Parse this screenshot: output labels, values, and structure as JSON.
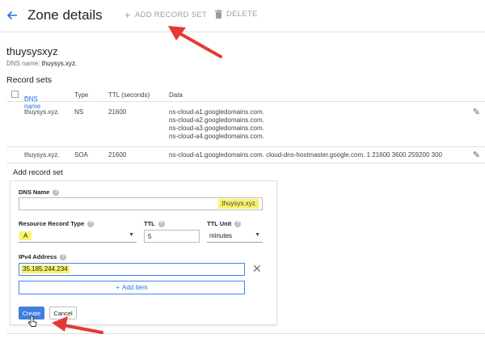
{
  "header": {
    "title": "Zone details",
    "add_record_set": "ADD RECORD SET",
    "delete": "DELETE"
  },
  "zone": {
    "name": "thuysysxyz",
    "dns_label": "DNS name:",
    "dns_value": "thuysys.xyz."
  },
  "record_sets": {
    "title": "Record sets",
    "columns": {
      "dns_name": "DNS name",
      "type": "Type",
      "ttl": "TTL (seconds)",
      "data": "Data"
    },
    "rows": [
      {
        "dns_name": "thuysys.xyz.",
        "type": "NS",
        "ttl": "21600",
        "data": [
          "ns-cloud-a1.googledomains.com.",
          "ns-cloud-a2.googledomains.com.",
          "ns-cloud-a3.googledomains.com.",
          "ns-cloud-a4.googledomains.com."
        ]
      },
      {
        "dns_name": "thuysys.xyz.",
        "type": "SOA",
        "ttl": "21600",
        "data": [
          "ns-cloud-a1.googledomains.com. cloud-dns-hostmaster.google.com. 1 21600 3600 259200 300"
        ]
      }
    ]
  },
  "add_record": {
    "title": "Add record set",
    "dns_name_label": "DNS Name",
    "dns_name_value": "",
    "dns_suffix": ".thuysys.xyz.",
    "rr_type_label": "Resource Record Type",
    "rr_type_value": "A",
    "ttl_label": "TTL",
    "ttl_value": "5",
    "ttl_unit_label": "TTL Unit",
    "ttl_unit_value": "minutes",
    "ipv4_label": "IPv4 Address",
    "ipv4_value": "35.185.244.234",
    "add_item": "Add item",
    "create": "Create",
    "cancel": "Cancel"
  },
  "icons": {
    "back": "arrow-back-icon",
    "add": "plus-icon",
    "delete": "trash-icon",
    "edit": "pencil-icon",
    "help": "help-icon",
    "clear": "close-icon",
    "sort": "sort-up-icon",
    "dropdown": "chevron-down-icon"
  },
  "colors": {
    "accent": "#1a73e8",
    "highlight": "#f7f46b",
    "annotation_arrow": "#e53935"
  }
}
